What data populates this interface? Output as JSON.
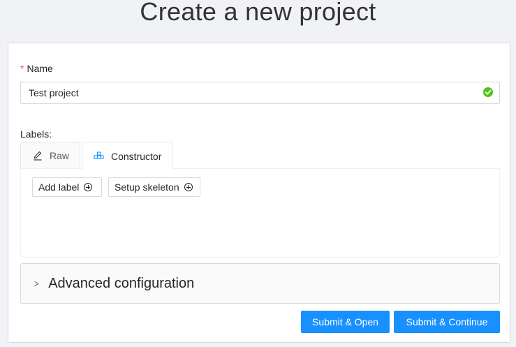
{
  "header": {
    "title": "Create a new project"
  },
  "form": {
    "name": {
      "required_mark": "*",
      "label": "Name",
      "value": "Test project",
      "status_icon": "check-circle-icon"
    },
    "labels": {
      "label": "Labels:",
      "tabs": [
        {
          "label": "Raw",
          "icon": "edit-pencil-icon",
          "active": false
        },
        {
          "label": "Constructor",
          "icon": "build-blocks-icon",
          "active": true
        }
      ],
      "buttons": {
        "add_label": "Add label",
        "setup_skeleton": "Setup skeleton"
      }
    },
    "advanced": {
      "title": "Advanced configuration",
      "expanded": false
    },
    "actions": {
      "submit_open": "Submit & Open",
      "submit_continue": "Submit & Continue"
    }
  },
  "colors": {
    "primary": "#1890ff",
    "required": "#ff4d4f",
    "success": "#52c41a",
    "page_bg": "#f1f2f5"
  }
}
